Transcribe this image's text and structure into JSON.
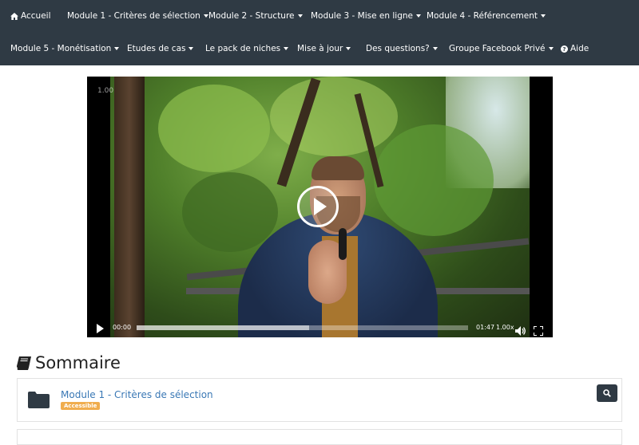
{
  "navbar": {
    "row1": [
      {
        "label": "Accueil",
        "icon": "home-icon",
        "dropdown": false
      },
      {
        "label": "Module 1 - Critères de sélection",
        "dropdown": true
      },
      {
        "label": "Module 2 - Structure",
        "dropdown": true
      },
      {
        "label": "Module 3 - Mise en ligne",
        "dropdown": true
      },
      {
        "label": "Module 4 - Référencement",
        "dropdown": true
      }
    ],
    "row2": [
      {
        "label": "Module 5 - Monétisation",
        "dropdown": true
      },
      {
        "label": "Etudes de cas",
        "dropdown": true
      },
      {
        "label": "Le pack de niches",
        "dropdown": true
      },
      {
        "label": "Mise à jour",
        "dropdown": true
      },
      {
        "label": "Des questions?",
        "dropdown": true
      },
      {
        "label": "Groupe Facebook Privé",
        "dropdown": true
      },
      {
        "label": "Aide",
        "icon": "question-circle-icon",
        "dropdown": false
      }
    ]
  },
  "video": {
    "speed_overlay": "1.00",
    "current_time": "00:00",
    "duration": "01:47",
    "speed": "1.00x",
    "buffered_fraction": 0.52
  },
  "summary": {
    "title": "Sommaire",
    "icon": "book-icon"
  },
  "modules": [
    {
      "title": "Module 1 - Critères de sélection",
      "badge": "Accessible",
      "icon": "folder-icon",
      "action_icon": "search-icon"
    }
  ],
  "colors": {
    "navbar_bg": "#2f3a44",
    "link": "#3a78b5",
    "badge": "#f0ad4e"
  }
}
